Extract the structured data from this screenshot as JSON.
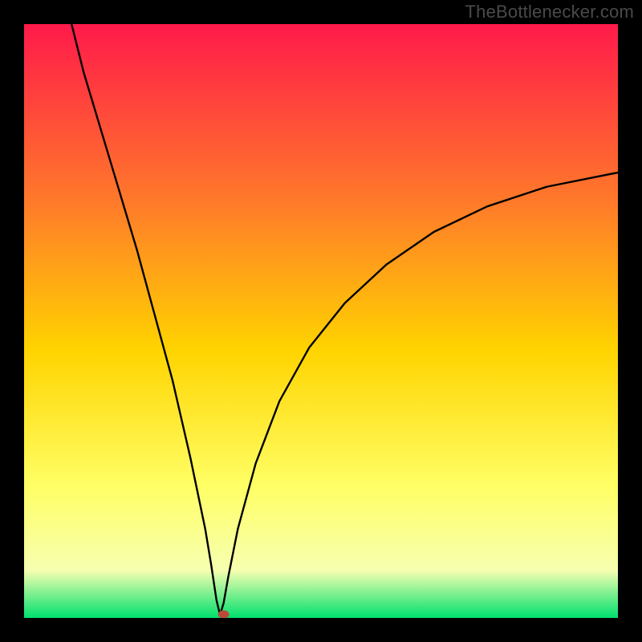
{
  "watermark": "TheBottlenecker.com",
  "chart_data": {
    "type": "line",
    "title": "",
    "xlabel": "",
    "ylabel": "",
    "xlim": [
      0,
      100
    ],
    "ylim": [
      0,
      100
    ],
    "gradient_colors": {
      "top": "#ff1a4a",
      "mid_upper": "#ff7a2a",
      "mid": "#ffd400",
      "lower": "#ffff66",
      "near_bottom": "#f6ffb0",
      "bottom": "#00e06e"
    },
    "curve_description": "V-shaped bottleneck curve: starts near 100% at x≈8, descends steeply to a minimum near x≈33 y≈0, then rises with decreasing slope toward x=100 y≈75.",
    "series": [
      {
        "name": "bottleneck_curve",
        "x": [
          8,
          10,
          13,
          16,
          19,
          22,
          25,
          28,
          30.5,
          31.5,
          32.4,
          33,
          33.6,
          34.4,
          36,
          39,
          43,
          48,
          54,
          61,
          69,
          78,
          88,
          100
        ],
        "y": [
          100,
          92,
          82,
          72,
          62,
          51,
          40,
          27,
          15,
          9,
          3,
          0.5,
          2.5,
          7,
          15,
          26,
          36.5,
          45.5,
          53,
          59.5,
          65,
          69.3,
          72.6,
          75
        ]
      }
    ],
    "marker": {
      "x": 33.6,
      "y": 0.6,
      "color": "#b94a3a",
      "rx": 7,
      "ry": 5
    }
  }
}
